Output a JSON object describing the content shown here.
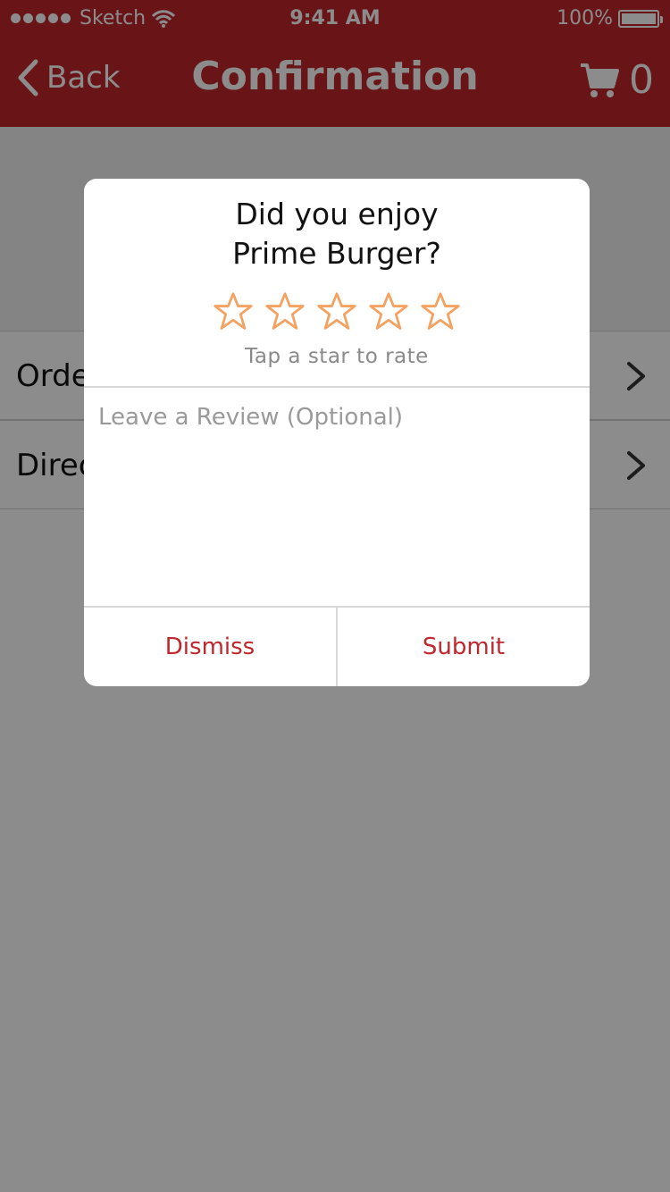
{
  "status_bar": {
    "carrier": "Sketch",
    "time": "9:41 AM",
    "battery": "100%"
  },
  "navbar": {
    "back_label": "Back",
    "title": "Confirmation",
    "cart_count": "0"
  },
  "colors": {
    "brand": "#c0272d",
    "star_outline": "#f4a261",
    "overlay": "rgba(0,0,0,0.45)"
  },
  "dialog": {
    "title_line1": "Did you enjoy",
    "title_line2": "Prime Burger?",
    "rating": {
      "value": 0,
      "max": 5
    },
    "rate_hint": "Tap a star to rate",
    "review_placeholder": "Leave a Review (Optional)",
    "dismiss_label": "Dismiss",
    "submit_label": "Submit"
  }
}
